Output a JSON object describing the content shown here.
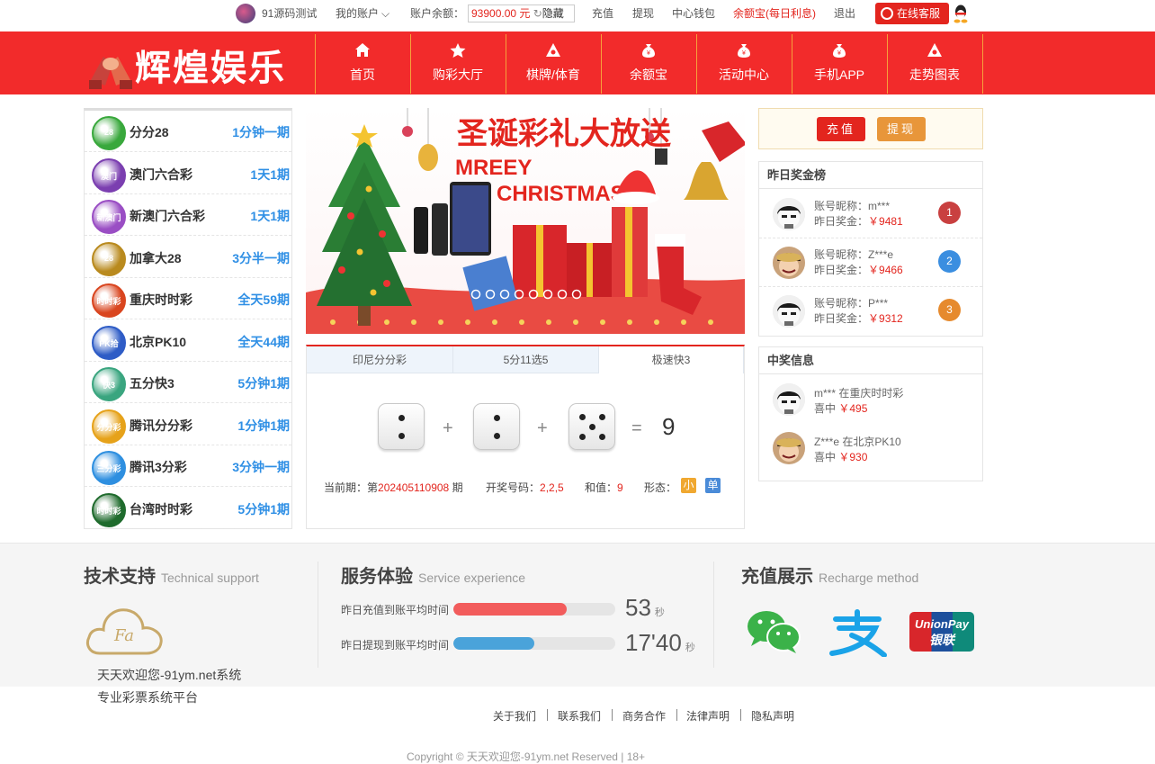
{
  "topbar": {
    "site_name": "91源码测试",
    "my_account": "我的账户",
    "balance_label": "账户余额：",
    "balance_value": "93900.00 元",
    "hide": "隐藏",
    "recharge": "充值",
    "withdraw": "提现",
    "wallet": "中心钱包",
    "yuebao": "余额宝(每日利息)",
    "logout": "退出",
    "online_service": "在线客服"
  },
  "logo": {
    "text": "辉煌娱乐"
  },
  "nav": [
    {
      "label": "首页",
      "icon": "home-icon"
    },
    {
      "label": "购彩大厅",
      "icon": "star-icon"
    },
    {
      "label": "棋牌/体育",
      "icon": "triangle-icon"
    },
    {
      "label": "余额宝",
      "icon": "money-bag-icon"
    },
    {
      "label": "活动中心",
      "icon": "money-bag-icon"
    },
    {
      "label": "手机APP",
      "icon": "money-bag-icon"
    },
    {
      "label": "走势图表",
      "icon": "triangle-icon"
    }
  ],
  "lotteries": [
    {
      "name": "分分28",
      "period": "1分钟一期",
      "badge": "28",
      "color": "#39a83c"
    },
    {
      "name": "澳门六合彩",
      "period": "1天1期",
      "badge": "澳门",
      "color": "#7b3fb0"
    },
    {
      "name": "新澳门六合彩",
      "period": "1天1期",
      "badge": "新澳门",
      "color": "#9a4ec4"
    },
    {
      "name": "加拿大28",
      "period": "3分半一期",
      "badge": "28",
      "color": "#b98a1e"
    },
    {
      "name": "重庆时时彩",
      "period": "全天59期",
      "badge": "时时彩",
      "color": "#d9451f"
    },
    {
      "name": "北京PK10",
      "period": "全天44期",
      "badge": "PK拾",
      "color": "#2e5cc6"
    },
    {
      "name": "五分快3",
      "period": "5分钟1期",
      "badge": "快3",
      "color": "#3aa57f"
    },
    {
      "name": "腾讯分分彩",
      "period": "1分钟1期",
      "badge": "分分彩",
      "color": "#e6a21a"
    },
    {
      "name": "腾讯3分彩",
      "period": "3分钟一期",
      "badge": "三分彩",
      "color": "#2e8fe0"
    },
    {
      "name": "台湾时时彩",
      "period": "5分钟1期",
      "badge": "时时彩",
      "color": "#1f6b2d"
    }
  ],
  "banner": {
    "title": "圣诞彩礼大放送",
    "subtitle_1": "MREEY",
    "subtitle_2": "CHRISTMAS",
    "slides": 8
  },
  "draw_tabs": [
    "印尼分分彩",
    "5分11选5",
    "极速快3"
  ],
  "draw": {
    "dice": [
      2,
      2,
      5
    ],
    "plus": "+",
    "equals": "=",
    "sum": "9",
    "period_label": "当前期：第",
    "period_value": "202405110908",
    "period_suffix": "期",
    "code_label": "开奖号码：",
    "code_value": "2,2,5",
    "sum_label": "和值：",
    "sum_value": "9",
    "shape_label": "形态：",
    "tag_small": "小",
    "tag_odd": "单"
  },
  "actions": {
    "recharge": "充值",
    "withdraw": "提现"
  },
  "leaderboard": {
    "title": "昨日奖金榜",
    "rows": [
      {
        "nick_label": "账号昵称：",
        "nick": "m***",
        "prize_label": "昨日奖金：",
        "prize": "￥9481",
        "rank": "1",
        "rank_color": "#c94040"
      },
      {
        "nick_label": "账号昵称：",
        "nick": "Z***e",
        "prize_label": "昨日奖金：",
        "prize": "￥9466",
        "rank": "2",
        "rank_color": "#3a8ee0"
      },
      {
        "nick_label": "账号昵称：",
        "nick": "P***",
        "prize_label": "昨日奖金：",
        "prize": "￥9312",
        "rank": "3",
        "rank_color": "#e68a2e"
      }
    ]
  },
  "winners": {
    "title": "中奖信息",
    "rows": [
      {
        "line": "m*** 在重庆时时彩",
        "win_label": "喜中",
        "amount": "￥495"
      },
      {
        "line": "Z***e 在北京PK10",
        "win_label": "喜中",
        "amount": "￥930"
      }
    ]
  },
  "footer": {
    "support_title": "技术支持",
    "support_en": "Technical support",
    "welcome": "天天欢迎您-91ym.net系统",
    "platform": "专业彩票系统平台",
    "service_title": "服务体验",
    "service_en": "Service experience",
    "recharge_time_label": "昨日充值到账平均时间",
    "recharge_time": "53",
    "recharge_fill": 0.7,
    "withdraw_time_label": "昨日提现到账平均时间",
    "withdraw_time": "17'40",
    "withdraw_fill": 0.5,
    "sec": "秒",
    "pay_title": "充值展示",
    "pay_en": "Recharge method",
    "unionpay_1": "UnionPay",
    "unionpay_2": "银联"
  },
  "links": [
    "关于我们",
    "联系我们",
    "商务合作",
    "法律声明",
    "隐私声明"
  ],
  "copyright": "Copyright © 天天欢迎您-91ym.net Reserved | 18+"
}
